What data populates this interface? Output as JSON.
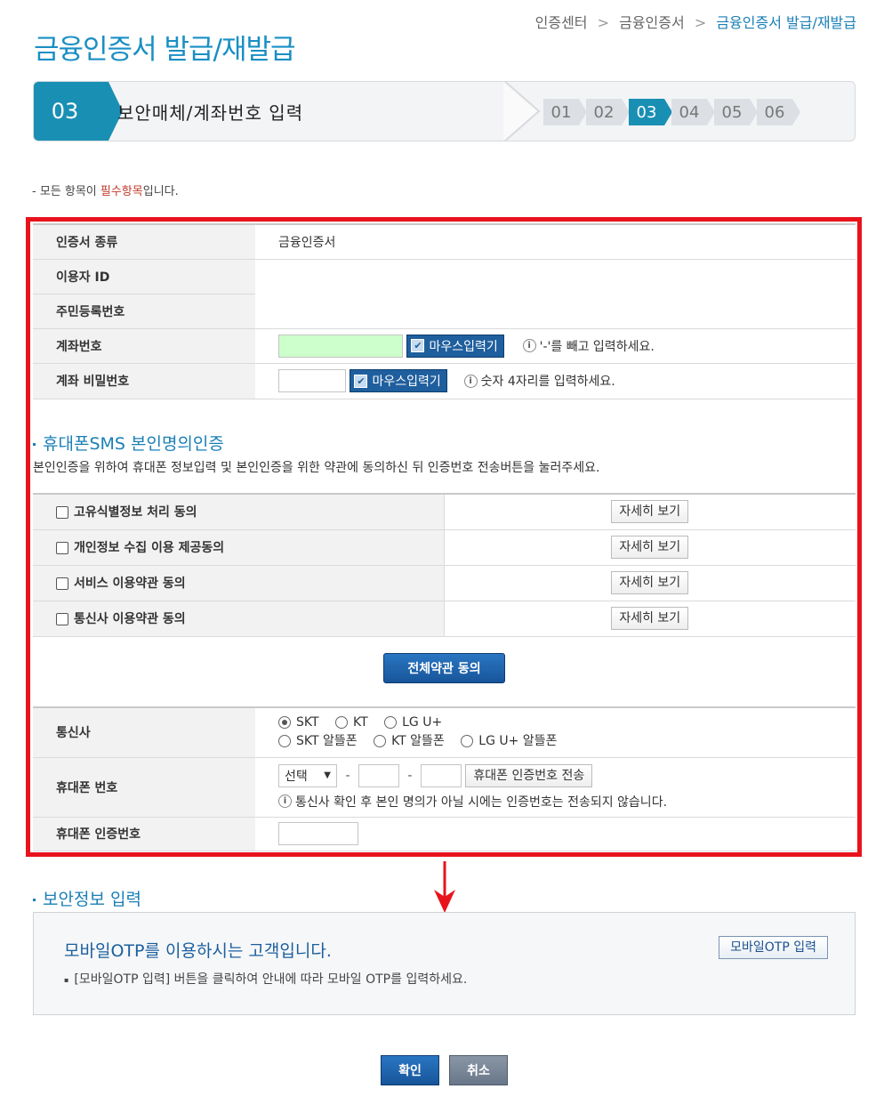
{
  "breadcrumb": {
    "items": [
      "인증센터",
      "금융인증서"
    ],
    "current": "금융인증서 발급/재발급",
    "separator": ">"
  },
  "page_title": "금융인증서 발급/재발급",
  "stepbar": {
    "current_number": "03",
    "current_label": "보안매체/계좌번호 입력",
    "steps": [
      "01",
      "02",
      "03",
      "04",
      "05",
      "06"
    ],
    "active_step": "03"
  },
  "notice": {
    "prefix": "- 모든 항목이 ",
    "required": "필수항목",
    "suffix": "입니다."
  },
  "form": {
    "cert_type_label": "인증서 종류",
    "cert_type_value": "금융인증서",
    "user_id_label": "이용자 ID",
    "rrn_label": "주민등록번호",
    "account_label": "계좌번호",
    "account_mouse_btn": "마우스입력기",
    "account_hint": "'-'를 빼고 입력하세요.",
    "pw_label": "계좌 비밀번호",
    "pw_mouse_btn": "마우스입력기",
    "pw_hint": "숫자 4자리를 입력하세요."
  },
  "sms": {
    "title": "휴대폰SMS 본인명의인증",
    "desc": "본인인증을 위하여 휴대폰 정보입력 및 본인인증을 위한 약관에 동의하신 뒤 인증번호 전송버튼을 눌러주세요.",
    "terms": [
      {
        "label": "고유식별정보 처리 동의",
        "button": "자세히 보기"
      },
      {
        "label": "개인정보 수집 이용 제공동의",
        "button": "자세히 보기"
      },
      {
        "label": "서비스 이용약관 동의",
        "button": "자세히 보기"
      },
      {
        "label": "통신사 이용약관 동의",
        "button": "자세히 보기"
      }
    ],
    "agree_all": "전체약관 동의",
    "carrier_label": "통신사",
    "carriers_row1": [
      "SKT",
      "KT",
      "LG U+"
    ],
    "carriers_row2": [
      "SKT 알뜰폰",
      "KT 알뜰폰",
      "LG U+ 알뜰폰"
    ],
    "selected_carrier": "SKT",
    "phone_label": "휴대폰 번호",
    "phone_select": "선택",
    "phone_dash": "-",
    "send_btn": "휴대폰 인증번호 전송",
    "phone_hint": "통신사 확인 후 본인 명의가 아닐 시에는 인증번호는 전송되지 않습니다.",
    "code_label": "휴대폰 인증번호"
  },
  "security": {
    "title": "보안정보 입력",
    "otp_title": "모바일OTP를 이용하시는 고객입니다.",
    "otp_desc": "[모바일OTP 입력] 버튼을 클릭하여 안내에 따라 모바일 OTP를 입력하세요.",
    "otp_btn": "모바일OTP 입력"
  },
  "buttons": {
    "confirm": "확인",
    "cancel": "취소"
  },
  "colors": {
    "brand": "#1a8fb4",
    "highlight_box": "#e8131c",
    "account_input_bg": "#ccffcc"
  }
}
